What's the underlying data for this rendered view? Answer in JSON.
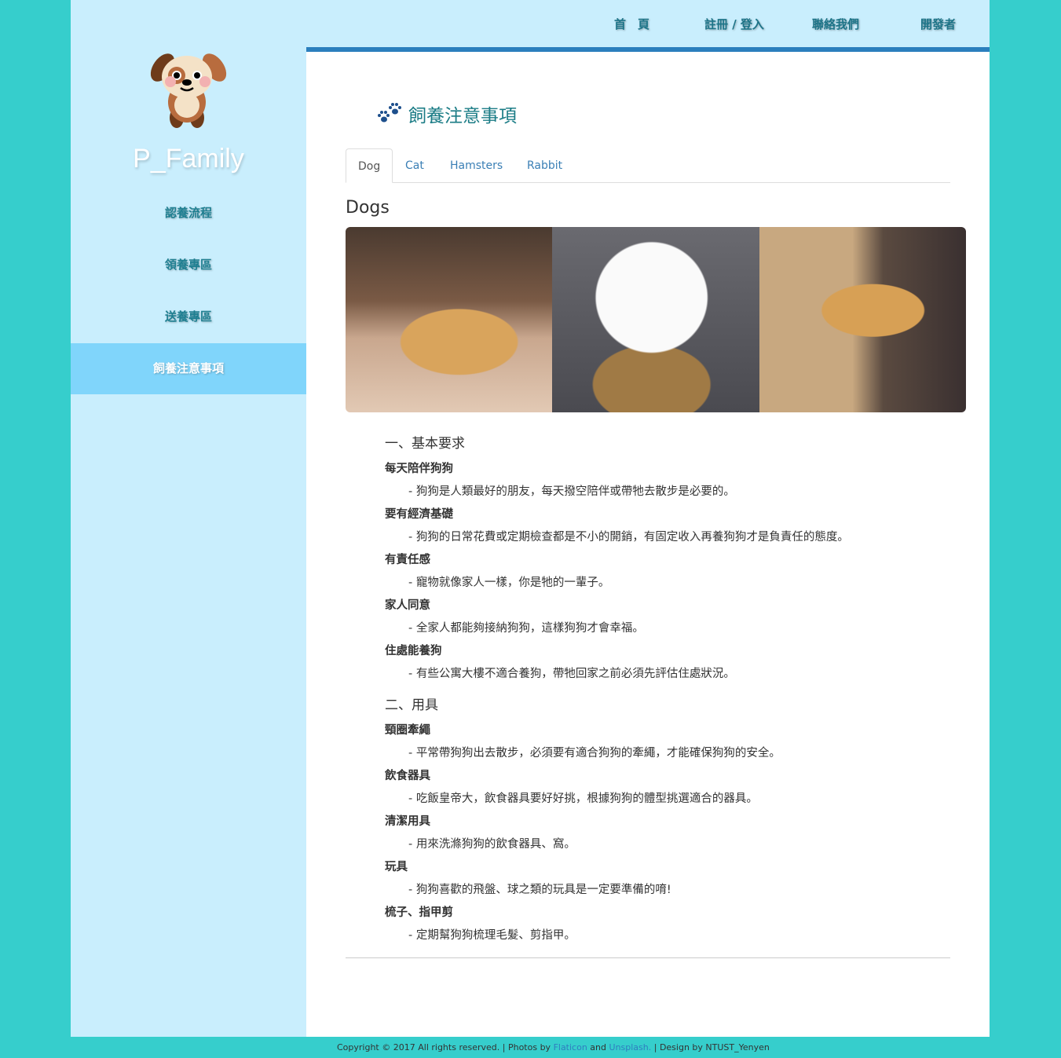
{
  "brand": "P_Family",
  "sidebar": {
    "items": [
      {
        "label": "認養流程"
      },
      {
        "label": "領養專區"
      },
      {
        "label": "送養專區"
      },
      {
        "label": "飼養注意事項",
        "active": true
      }
    ]
  },
  "nav": {
    "items": [
      {
        "label": "首　頁"
      },
      {
        "label": "註冊 / 登入"
      },
      {
        "label": "聯絡我們"
      },
      {
        "label": "開發者"
      }
    ]
  },
  "page": {
    "title": "飼養注意事項",
    "icon": "paw-icon",
    "tabs": [
      {
        "label": "Dog",
        "active": true
      },
      {
        "label": "Cat"
      },
      {
        "label": "Hamsters"
      },
      {
        "label": "Rabbit"
      }
    ],
    "heading": "Dogs",
    "sections": [
      {
        "title": "一、基本要求",
        "items": [
          {
            "name": "每天陪伴狗狗",
            "desc": "- 狗狗是人類最好的朋友，每天撥空陪伴或帶牠去散步是必要的。"
          },
          {
            "name": "要有經濟基礎",
            "desc": "- 狗狗的日常花費或定期檢查都是不小的開銷，有固定收入再養狗狗才是負責任的態度。"
          },
          {
            "name": "有責任感",
            "desc": "- 寵物就像家人一樣，你是牠的一輩子。"
          },
          {
            "name": "家人同意",
            "desc": "- 全家人都能夠接納狗狗，這樣狗狗才會幸福。"
          },
          {
            "name": "住處能養狗",
            "desc": "- 有些公寓大樓不適合養狗，帶牠回家之前必須先評估住處狀況。"
          }
        ]
      },
      {
        "title": "二、用具",
        "items": [
          {
            "name": "頸圈牽繩",
            "desc": "- 平常帶狗狗出去散步，必須要有適合狗狗的牽繩，才能確保狗狗的安全。"
          },
          {
            "name": "飲食器具",
            "desc": "- 吃飯皇帝大，飲食器具要好好挑，根據狗狗的體型挑選適合的器具。"
          },
          {
            "name": "清潔用具",
            "desc": "- 用來洗滌狗狗的飲食器具、窩。"
          },
          {
            "name": "玩具",
            "desc": "- 狗狗喜歡的飛盤、球之類的玩具是一定要準備的唷!"
          },
          {
            "name": "梳子、指甲剪",
            "desc": "- 定期幫狗狗梳理毛髮、剪指甲。"
          }
        ]
      }
    ]
  },
  "footer": {
    "pre": "Copyright © 2017 All rights reserved. | Photos by ",
    "flaticon": "Flaticon",
    "and": " and ",
    "unsplash": "Unsplash.",
    "post": " | Design by NTUST_Yenyen"
  },
  "colors": {
    "background": "#36cecc",
    "sidebar": "#c9eefd",
    "active": "#80d5fb",
    "accent": "#2b7fbd"
  }
}
